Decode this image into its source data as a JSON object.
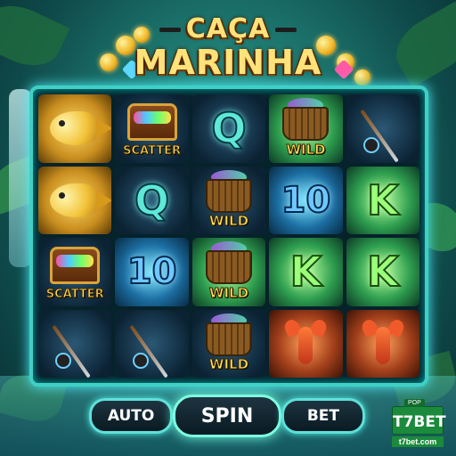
{
  "title": {
    "line1": "CAÇA",
    "line2": "MARINHA"
  },
  "grid": {
    "rows": [
      [
        {
          "symbol": "gold-fish",
          "label": "",
          "style": "gold"
        },
        {
          "symbol": "treasure-chest",
          "label": "SCATTER",
          "style": "dark"
        },
        {
          "symbol": "Q",
          "label": "",
          "style": "dark"
        },
        {
          "symbol": "fish-basket",
          "label": "WILD",
          "style": "glow-green"
        },
        {
          "symbol": "fishing-rod",
          "label": "",
          "style": "dark"
        }
      ],
      [
        {
          "symbol": "gold-fish",
          "label": "",
          "style": "gold"
        },
        {
          "symbol": "Q",
          "label": "",
          "style": "dark"
        },
        {
          "symbol": "fish-basket",
          "label": "WILD",
          "style": "dark"
        },
        {
          "symbol": "10",
          "label": "",
          "style": "glow-blue"
        },
        {
          "symbol": "K",
          "label": "",
          "style": "glow-green"
        }
      ],
      [
        {
          "symbol": "treasure-chest",
          "label": "SCATTER",
          "style": "dark"
        },
        {
          "symbol": "10",
          "label": "",
          "style": "glow-blue"
        },
        {
          "symbol": "fish-basket",
          "label": "WILD",
          "style": "glow-green"
        },
        {
          "symbol": "K",
          "label": "",
          "style": "glow-green"
        },
        {
          "symbol": "K",
          "label": "",
          "style": "glow-green"
        }
      ],
      [
        {
          "symbol": "fishing-rod",
          "label": "",
          "style": "dark"
        },
        {
          "symbol": "fishing-rod",
          "label": "",
          "style": "dark"
        },
        {
          "symbol": "fish-basket",
          "label": "WILD",
          "style": "dark"
        },
        {
          "symbol": "lobster",
          "label": "",
          "style": "glow-orange"
        },
        {
          "symbol": "lobster",
          "label": "",
          "style": "glow-orange"
        }
      ]
    ]
  },
  "controls": {
    "auto_label": "AUTO",
    "spin_label": "SPIN",
    "bet_label": "BET"
  },
  "brand": {
    "tag": "POP",
    "name": "T7BET",
    "url": "t7bet.com"
  },
  "colors": {
    "frame": "#3fd0c4",
    "title": "#ffe27a",
    "brand": "#1b8a3c"
  }
}
